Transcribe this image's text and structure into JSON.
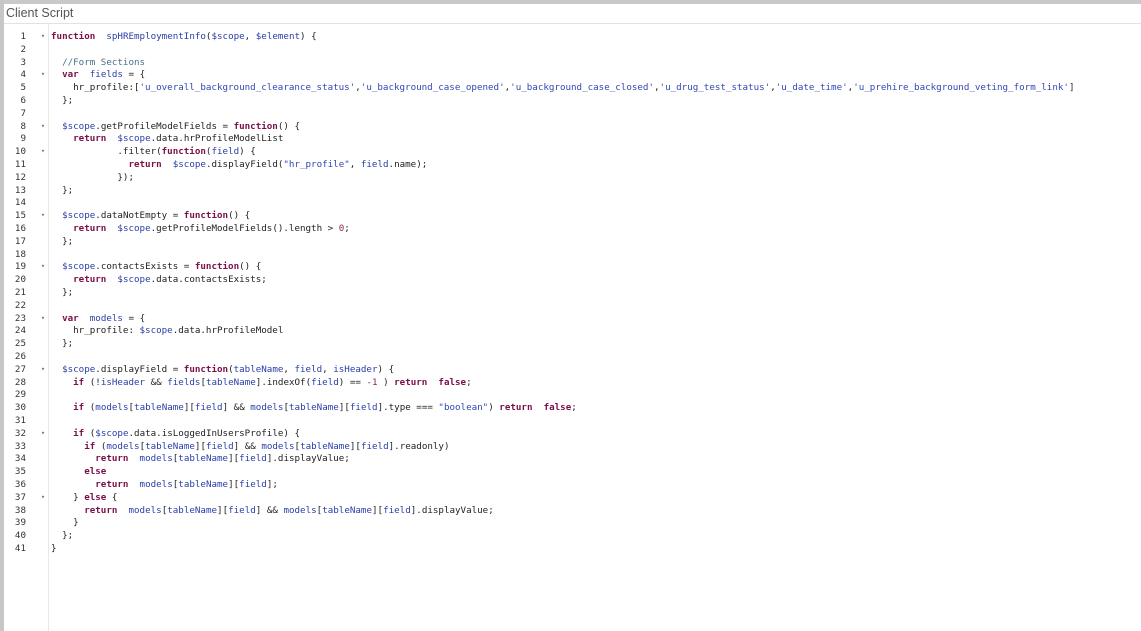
{
  "panel": {
    "title": "Client Script"
  },
  "fold_glyph": "▾",
  "lines": [
    {
      "n": "1",
      "fold": true,
      "t": [
        [
          "k",
          "function"
        ],
        [
          "",
          "  "
        ],
        [
          "v",
          "spHREmploymentInfo"
        ],
        [
          "",
          "("
        ],
        [
          "v",
          "$scope"
        ],
        [
          "",
          ", "
        ],
        [
          "v",
          "$element"
        ],
        [
          "",
          ") {"
        ]
      ]
    },
    {
      "n": "2",
      "fold": false,
      "t": []
    },
    {
      "n": "3",
      "fold": false,
      "t": [
        [
          "",
          "  "
        ],
        [
          "c",
          "//Form Sections"
        ]
      ]
    },
    {
      "n": "4",
      "fold": true,
      "t": [
        [
          "",
          "  "
        ],
        [
          "k",
          "var"
        ],
        [
          "",
          "  "
        ],
        [
          "v",
          "fields"
        ],
        [
          "",
          " = {"
        ]
      ]
    },
    {
      "n": "5",
      "fold": false,
      "t": [
        [
          "",
          "    hr_profile:["
        ],
        [
          "s",
          "'u_overall_background_clearance_status'"
        ],
        [
          "",
          ","
        ],
        [
          "s",
          "'u_background_case_opened'"
        ],
        [
          "",
          ","
        ],
        [
          "s",
          "'u_background_case_closed'"
        ],
        [
          "",
          ","
        ],
        [
          "s",
          "'u_drug_test_status'"
        ],
        [
          "",
          ","
        ],
        [
          "s",
          "'u_date_time'"
        ],
        [
          "",
          ","
        ],
        [
          "s",
          "'u_prehire_background_veting_form_link'"
        ],
        [
          "",
          "]"
        ]
      ]
    },
    {
      "n": "6",
      "fold": false,
      "t": [
        [
          "",
          "  };"
        ]
      ]
    },
    {
      "n": "7",
      "fold": false,
      "t": []
    },
    {
      "n": "8",
      "fold": true,
      "t": [
        [
          "",
          "  "
        ],
        [
          "v",
          "$scope"
        ],
        [
          "",
          ".getProfileModelFields = "
        ],
        [
          "k",
          "function"
        ],
        [
          "",
          "() {"
        ]
      ]
    },
    {
      "n": "9",
      "fold": false,
      "t": [
        [
          "",
          "    "
        ],
        [
          "k",
          "return"
        ],
        [
          "",
          "  "
        ],
        [
          "v",
          "$scope"
        ],
        [
          "",
          ".data.hrProfileModelList"
        ]
      ]
    },
    {
      "n": "10",
      "fold": true,
      "t": [
        [
          "",
          "            .filter("
        ],
        [
          "k",
          "function"
        ],
        [
          "",
          "("
        ],
        [
          "v",
          "field"
        ],
        [
          "",
          ") {"
        ]
      ]
    },
    {
      "n": "11",
      "fold": false,
      "t": [
        [
          "",
          "              "
        ],
        [
          "k",
          "return"
        ],
        [
          "",
          "  "
        ],
        [
          "v",
          "$scope"
        ],
        [
          "",
          ".displayField("
        ],
        [
          "s",
          "\"hr_profile\""
        ],
        [
          "",
          ", "
        ],
        [
          "v",
          "field"
        ],
        [
          "",
          ".name);"
        ]
      ]
    },
    {
      "n": "12",
      "fold": false,
      "t": [
        [
          "",
          "            });"
        ]
      ]
    },
    {
      "n": "13",
      "fold": false,
      "t": [
        [
          "",
          "  };"
        ]
      ]
    },
    {
      "n": "14",
      "fold": false,
      "t": []
    },
    {
      "n": "15",
      "fold": true,
      "t": [
        [
          "",
          "  "
        ],
        [
          "v",
          "$scope"
        ],
        [
          "",
          ".dataNotEmpty = "
        ],
        [
          "k",
          "function"
        ],
        [
          "",
          "() {"
        ]
      ]
    },
    {
      "n": "16",
      "fold": false,
      "t": [
        [
          "",
          "    "
        ],
        [
          "k",
          "return"
        ],
        [
          "",
          "  "
        ],
        [
          "v",
          "$scope"
        ],
        [
          "",
          ".getProfileModelFields().length > "
        ],
        [
          "n",
          "0"
        ],
        [
          "",
          ";"
        ]
      ]
    },
    {
      "n": "17",
      "fold": false,
      "t": [
        [
          "",
          "  };"
        ]
      ]
    },
    {
      "n": "18",
      "fold": false,
      "t": []
    },
    {
      "n": "19",
      "fold": true,
      "t": [
        [
          "",
          "  "
        ],
        [
          "v",
          "$scope"
        ],
        [
          "",
          ".contactsExists = "
        ],
        [
          "k",
          "function"
        ],
        [
          "",
          "() {"
        ]
      ]
    },
    {
      "n": "20",
      "fold": false,
      "t": [
        [
          "",
          "    "
        ],
        [
          "k",
          "return"
        ],
        [
          "",
          "  "
        ],
        [
          "v",
          "$scope"
        ],
        [
          "",
          ".data.contactsExists;"
        ]
      ]
    },
    {
      "n": "21",
      "fold": false,
      "t": [
        [
          "",
          "  };"
        ]
      ]
    },
    {
      "n": "22",
      "fold": false,
      "t": []
    },
    {
      "n": "23",
      "fold": true,
      "t": [
        [
          "",
          "  "
        ],
        [
          "k",
          "var"
        ],
        [
          "",
          "  "
        ],
        [
          "v",
          "models"
        ],
        [
          "",
          " = {"
        ]
      ]
    },
    {
      "n": "24",
      "fold": false,
      "t": [
        [
          "",
          "    hr_profile: "
        ],
        [
          "v",
          "$scope"
        ],
        [
          "",
          ".data.hrProfileModel"
        ]
      ]
    },
    {
      "n": "25",
      "fold": false,
      "t": [
        [
          "",
          "  };"
        ]
      ]
    },
    {
      "n": "26",
      "fold": false,
      "t": []
    },
    {
      "n": "27",
      "fold": true,
      "t": [
        [
          "",
          "  "
        ],
        [
          "v",
          "$scope"
        ],
        [
          "",
          ".displayField = "
        ],
        [
          "k",
          "function"
        ],
        [
          "",
          "("
        ],
        [
          "v",
          "tableName"
        ],
        [
          "",
          ", "
        ],
        [
          "v",
          "field"
        ],
        [
          "",
          ", "
        ],
        [
          "v",
          "isHeader"
        ],
        [
          "",
          ") {"
        ]
      ]
    },
    {
      "n": "28",
      "fold": false,
      "t": [
        [
          "",
          "    "
        ],
        [
          "k",
          "if"
        ],
        [
          "",
          " (!"
        ],
        [
          "v",
          "isHeader"
        ],
        [
          "",
          " && "
        ],
        [
          "v",
          "fields"
        ],
        [
          "",
          "["
        ],
        [
          "v",
          "tableName"
        ],
        [
          "",
          "].indexOf("
        ],
        [
          "v",
          "field"
        ],
        [
          "",
          ") == "
        ],
        [
          "n",
          "-1"
        ],
        [
          "",
          " ) "
        ],
        [
          "k",
          "return"
        ],
        [
          "",
          "  "
        ],
        [
          "k",
          "false"
        ],
        [
          "",
          ";"
        ]
      ]
    },
    {
      "n": "29",
      "fold": false,
      "t": []
    },
    {
      "n": "30",
      "fold": false,
      "t": [
        [
          "",
          "    "
        ],
        [
          "k",
          "if"
        ],
        [
          "",
          " ("
        ],
        [
          "v",
          "models"
        ],
        [
          "",
          "["
        ],
        [
          "v",
          "tableName"
        ],
        [
          "",
          "]["
        ],
        [
          "v",
          "field"
        ],
        [
          "",
          "] && "
        ],
        [
          "v",
          "models"
        ],
        [
          "",
          "["
        ],
        [
          "v",
          "tableName"
        ],
        [
          "",
          "]["
        ],
        [
          "v",
          "field"
        ],
        [
          "",
          "].type === "
        ],
        [
          "s",
          "\"boolean\""
        ],
        [
          "",
          ") "
        ],
        [
          "k",
          "return"
        ],
        [
          "",
          "  "
        ],
        [
          "k",
          "false"
        ],
        [
          "",
          ";"
        ]
      ]
    },
    {
      "n": "31",
      "fold": false,
      "t": []
    },
    {
      "n": "32",
      "fold": true,
      "t": [
        [
          "",
          "    "
        ],
        [
          "k",
          "if"
        ],
        [
          "",
          " ("
        ],
        [
          "v",
          "$scope"
        ],
        [
          "",
          ".data.isLoggedInUsersProfile) {"
        ]
      ]
    },
    {
      "n": "33",
      "fold": false,
      "t": [
        [
          "",
          "      "
        ],
        [
          "k",
          "if"
        ],
        [
          "",
          " ("
        ],
        [
          "v",
          "models"
        ],
        [
          "",
          "["
        ],
        [
          "v",
          "tableName"
        ],
        [
          "",
          "]["
        ],
        [
          "v",
          "field"
        ],
        [
          "",
          "] && "
        ],
        [
          "v",
          "models"
        ],
        [
          "",
          "["
        ],
        [
          "v",
          "tableName"
        ],
        [
          "",
          "]["
        ],
        [
          "v",
          "field"
        ],
        [
          "",
          "].readonly)"
        ]
      ]
    },
    {
      "n": "34",
      "fold": false,
      "t": [
        [
          "",
          "        "
        ],
        [
          "k",
          "return"
        ],
        [
          "",
          "  "
        ],
        [
          "v",
          "models"
        ],
        [
          "",
          "["
        ],
        [
          "v",
          "tableName"
        ],
        [
          "",
          "]["
        ],
        [
          "v",
          "field"
        ],
        [
          "",
          "].displayValue;"
        ]
      ]
    },
    {
      "n": "35",
      "fold": false,
      "t": [
        [
          "",
          "      "
        ],
        [
          "k",
          "else"
        ]
      ]
    },
    {
      "n": "36",
      "fold": false,
      "t": [
        [
          "",
          "        "
        ],
        [
          "k",
          "return"
        ],
        [
          "",
          "  "
        ],
        [
          "v",
          "models"
        ],
        [
          "",
          "["
        ],
        [
          "v",
          "tableName"
        ],
        [
          "",
          "]["
        ],
        [
          "v",
          "field"
        ],
        [
          "",
          "];"
        ]
      ]
    },
    {
      "n": "37",
      "fold": true,
      "t": [
        [
          "",
          "    } "
        ],
        [
          "k",
          "else"
        ],
        [
          "",
          " {"
        ]
      ]
    },
    {
      "n": "38",
      "fold": false,
      "t": [
        [
          "",
          "      "
        ],
        [
          "k",
          "return"
        ],
        [
          "",
          "  "
        ],
        [
          "v",
          "models"
        ],
        [
          "",
          "["
        ],
        [
          "v",
          "tableName"
        ],
        [
          "",
          "]["
        ],
        [
          "v",
          "field"
        ],
        [
          "",
          "] && "
        ],
        [
          "v",
          "models"
        ],
        [
          "",
          "["
        ],
        [
          "v",
          "tableName"
        ],
        [
          "",
          "]["
        ],
        [
          "v",
          "field"
        ],
        [
          "",
          "].displayValue;"
        ]
      ]
    },
    {
      "n": "39",
      "fold": false,
      "t": [
        [
          "",
          "    }"
        ]
      ]
    },
    {
      "n": "40",
      "fold": false,
      "t": [
        [
          "",
          "  };"
        ]
      ]
    },
    {
      "n": "41",
      "fold": false,
      "t": [
        [
          "",
          "}"
        ]
      ]
    }
  ]
}
